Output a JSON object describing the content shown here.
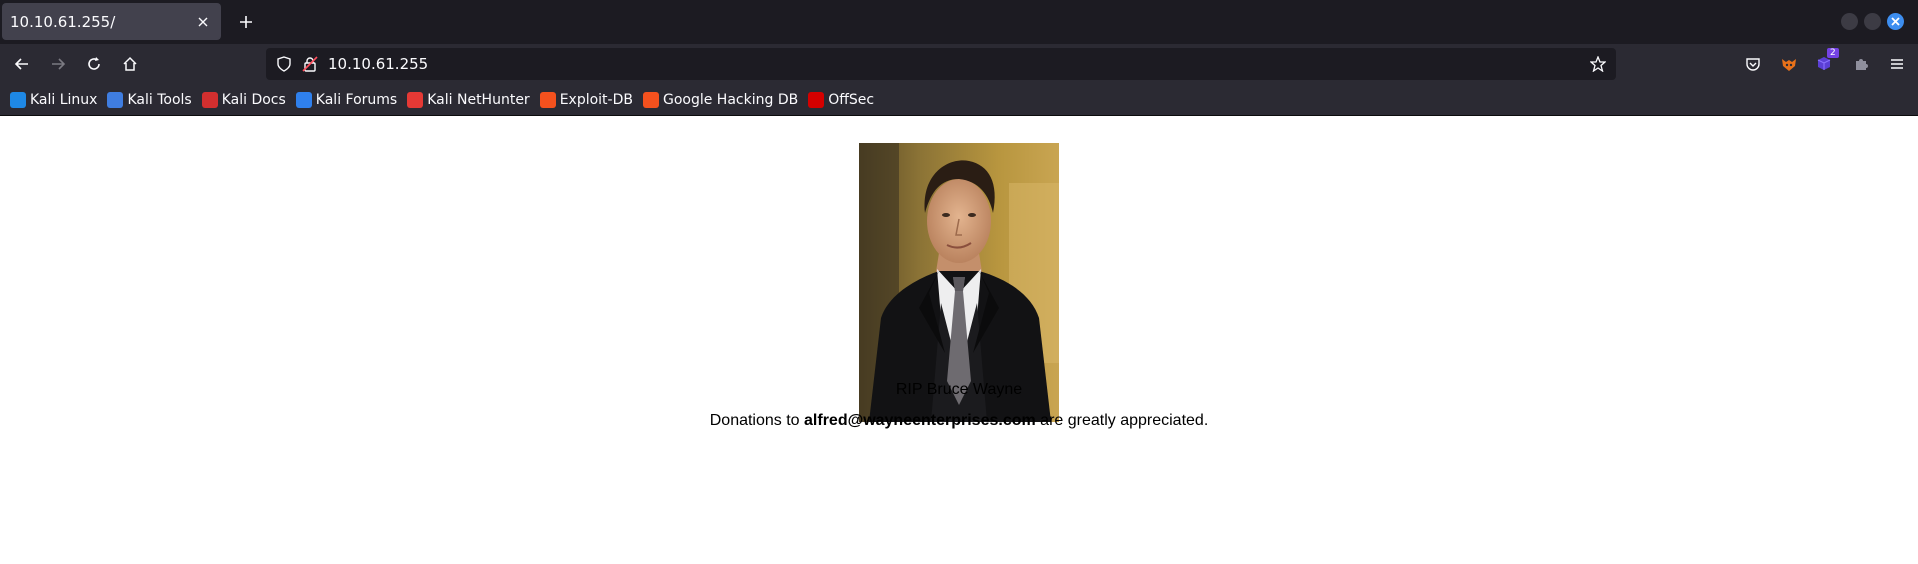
{
  "browser": {
    "tab": {
      "title": "10.10.61.255/"
    },
    "url": "10.10.61.255",
    "extension_badge": "2",
    "bookmarks": [
      {
        "label": "Kali Linux",
        "icon": "kali-linux-icon",
        "color": "#1e88e5"
      },
      {
        "label": "Kali Tools",
        "icon": "kali-tools-icon",
        "color": "#3f7de0"
      },
      {
        "label": "Kali Docs",
        "icon": "kali-docs-icon",
        "color": "#d32f2f"
      },
      {
        "label": "Kali Forums",
        "icon": "kali-forums-icon",
        "color": "#2f80ed"
      },
      {
        "label": "Kali NetHunter",
        "icon": "kali-nethunter-icon",
        "color": "#e53935"
      },
      {
        "label": "Exploit-DB",
        "icon": "exploit-db-icon",
        "color": "#f4511e"
      },
      {
        "label": "Google Hacking DB",
        "icon": "ghdb-icon",
        "color": "#f4511e"
      },
      {
        "label": "OffSec",
        "icon": "offsec-icon",
        "color": "#d50000"
      }
    ]
  },
  "page": {
    "caption": "RIP Bruce Wayne",
    "donation": {
      "prefix": "Donations to ",
      "email": "alfred@wayneenterprises.com",
      "suffix": " are greatly appreciated."
    }
  },
  "colors": {
    "tab_strip": "#1c1b22",
    "toolbar": "#2b2a33",
    "active_tab": "#42414d",
    "url_field": "#1c1b22",
    "close_button": "#3d8ef0"
  }
}
